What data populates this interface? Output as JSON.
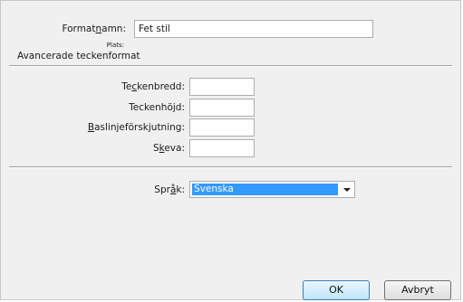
{
  "style_name": {
    "label_pre": "Format",
    "label_accel": "n",
    "label_post": "amn:",
    "value": "Fet stil"
  },
  "location_label": "Plats:",
  "section_title": "Avancerade teckenformat",
  "fields": {
    "char_width": {
      "pre": "Te",
      "accel": "c",
      "post": "kenbredd:",
      "value": ""
    },
    "char_height": {
      "pre": "Teckenhöjd:",
      "accel": "",
      "post": "",
      "value": ""
    },
    "baseline": {
      "pre": "",
      "accel": "B",
      "post": "aslinjeförskjutning:",
      "value": ""
    },
    "skew": {
      "pre": "S",
      "accel": "k",
      "post": "eva:",
      "value": ""
    }
  },
  "language": {
    "pre": "Spr",
    "accel": "å",
    "post": "k:",
    "value": "Svenska"
  },
  "buttons": {
    "ok": "OK",
    "cancel": "Avbryt"
  },
  "colors": {
    "selection": "#3399ff",
    "dialog_bg": "#f0f0f0"
  }
}
